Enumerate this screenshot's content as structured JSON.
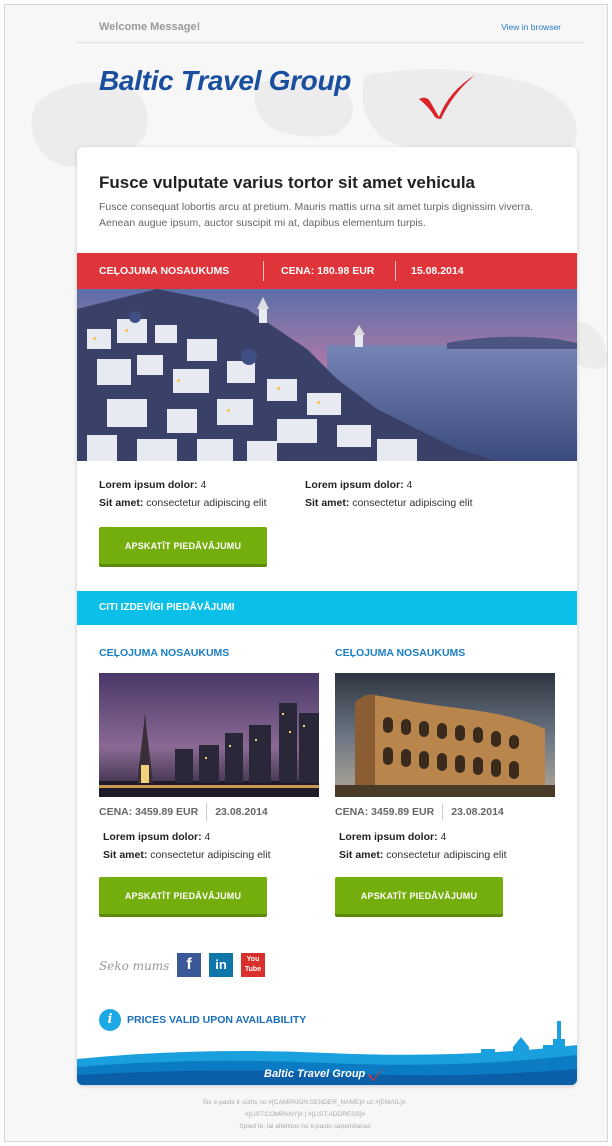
{
  "header": {
    "welcome": "Welcome Message!",
    "view_in_browser": "View in browser"
  },
  "brand": {
    "name": "Baltic Travel Group",
    "primary_color": "#1a4fa0",
    "check_color": "#d9252b"
  },
  "main": {
    "headline": "Fusce vulputate varius tortor sit amet vehicula",
    "intro": "Fusce consequat lobortis arcu at pretium. Mauris mattis urna sit amet turpis dignissim viverra. Aenean augue ipsum, auctor suscipit mi at, dapibus elementum turpis.",
    "offer_bar": {
      "name": "CEĻOJUMA NOSAUKUMS",
      "price": "CENA: 180.98 EUR",
      "date": "15.08.2014",
      "color": "#e0343b"
    },
    "attributes": [
      {
        "label": "Lorem ipsum dolor:",
        "value": " 4"
      },
      {
        "label": "Sit amet:",
        "value": " consectetur adipiscing elit"
      },
      {
        "label": "Lorem ipsum dolor:",
        "value": " 4"
      },
      {
        "label": "Sit amet:",
        "value": " consectetur adipiscing elit"
      }
    ],
    "button_label": "APSKATĪT PIEDĀVĀJUMU",
    "button_color": "#74ae0c"
  },
  "other_offers": {
    "title": "CITI IZDEVĪGI PIEDĀVĀJUMI",
    "color": "#0bc0e8",
    "items": [
      {
        "title": "CEĻOJUMA NOSAUKUMS",
        "price": "CENA: 3459.89 EUR",
        "date": "23.08.2014",
        "attr1_label": "Lorem ipsum dolor:",
        "attr1_value": " 4",
        "attr2_label": "Sit amet:",
        "attr2_value": " consectetur adipiscing elit",
        "button_label": "APSKATĪT PIEDĀVĀJUMU"
      },
      {
        "title": "CEĻOJUMA NOSAUKUMS",
        "price": "CENA: 3459.89 EUR",
        "date": "23.08.2014",
        "attr1_label": "Lorem ipsum dolor:",
        "attr1_value": " 4",
        "attr2_label": "Sit amet:",
        "attr2_value": " consectetur adipiscing elit",
        "button_label": "APSKATĪT PIEDĀVĀJUMU"
      }
    ]
  },
  "social": {
    "label": "Seko mums",
    "facebook": "f",
    "linkedin": "in",
    "youtube": "You Tube"
  },
  "info": {
    "icon": "i",
    "text": "PRICES VALID UPON AVAILABILITY"
  },
  "footer": {
    "brand": "Baltic Travel Group",
    "line1": "Šis e-pasts ir sūtīts no #[CAMPAIGN:SENDER_NAME]# uz #[EMAIL]#.",
    "line2": "#[LIST:COMPANY]# | #[LIST:ADDRESS]#",
    "line3": "Spied te, lai atteiktos no e-pastu saņemšanas"
  }
}
